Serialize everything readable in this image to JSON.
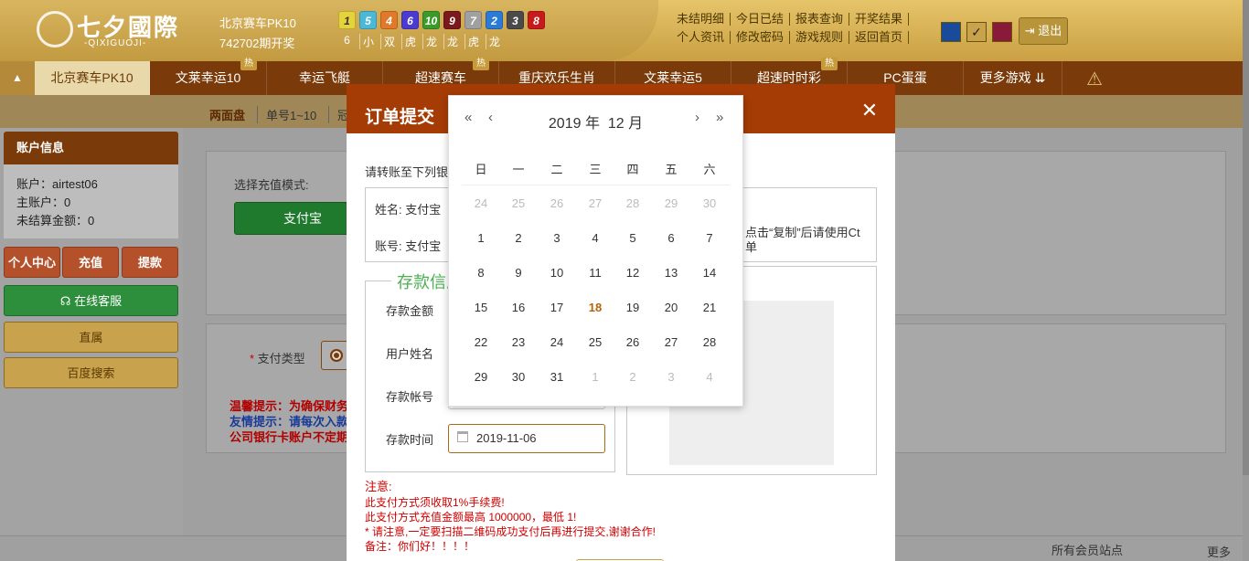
{
  "header": {
    "logo_main": "七夕國際",
    "logo_sub": "-QIXIGUOJI-",
    "game_name": "北京赛车PK10",
    "period": "742702期开奖",
    "balls": [
      {
        "n": "1",
        "color": "#e6d23a"
      },
      {
        "n": "5",
        "color": "#4bb8d8"
      },
      {
        "n": "4",
        "color": "#e07a2a"
      },
      {
        "n": "6",
        "color": "#4a3ad0"
      },
      {
        "n": "10",
        "color": "#3a9a2a"
      },
      {
        "n": "9",
        "color": "#7a1a1a"
      },
      {
        "n": "7",
        "color": "#a0a0a0"
      },
      {
        "n": "2",
        "color": "#2a7ad8"
      },
      {
        "n": "3",
        "color": "#4a4a4a"
      },
      {
        "n": "8",
        "color": "#c81a1a"
      }
    ],
    "ball_labels": [
      "6",
      "小",
      "双",
      "虎",
      "龙",
      "龙",
      "虎",
      "龙"
    ],
    "links": [
      "未结明细",
      "今日已结",
      "报表查询",
      "开奖结果",
      "个人资讯",
      "修改密码",
      "游戏规则",
      "返回首页"
    ],
    "theme_colors": [
      "#1a4a9a",
      "#c9a24e",
      "#8a1a3a"
    ],
    "logout": "退出"
  },
  "nav": {
    "tabs": [
      "北京赛车PK10",
      "文莱幸运10",
      "幸运飞艇",
      "超速赛车",
      "重庆欢乐生肖",
      "文莱幸运5",
      "超速时时彩",
      "PC蛋蛋",
      "更多游戏"
    ],
    "hot_label": "热"
  },
  "subnav": [
    "两面盘",
    "单号1~10",
    "冠"
  ],
  "account": {
    "title": "账户信息",
    "lines": [
      "账户：airtest06",
      "主账户：0",
      "未结算金额：0"
    ],
    "btn_center": "个人中心",
    "btn_deposit": "充值",
    "btn_withdraw": "提款",
    "btn_service": "在线客服",
    "btn_live": "直属",
    "btn_search": "百度搜索"
  },
  "content": {
    "mode_label": "选择充值模式:",
    "alipay": "支付宝",
    "pay_type": "支付类型",
    "tip1": "温馨提示：为确保财务",
    "tip2": "友情提示：请每次入款",
    "tip3": "公司银行卡账户不定期"
  },
  "modal": {
    "title": "订单提交",
    "transfer_text": "请转账至下列银",
    "name_label": "姓名:  支付宝",
    "account_label": "账号:  支付宝",
    "copy_hint_1": "点击“复制”后请使用Ct",
    "copy_hint_2": "单",
    "legend": "存款信息",
    "field_amount": "存款金额",
    "field_user": "用户姓名",
    "field_account": "存款帐号",
    "field_time": "存款时间",
    "time_value": "2019-11-06",
    "notes": [
      "注意:",
      "此支付方式须收取1%手续费!",
      "此支付方式充值金额最高 1000000，最低 1!",
      "* 请注意,一定要扫描二维码成功支付后再进行提交,谢谢合作!",
      "备注：你们好！！！！"
    ]
  },
  "calendar": {
    "year_label": "2019 年",
    "month_label": "12 月",
    "weekdays": [
      "日",
      "一",
      "二",
      "三",
      "四",
      "五",
      "六"
    ],
    "weeks": [
      [
        "24",
        "25",
        "26",
        "27",
        "28",
        "29",
        "30"
      ],
      [
        "1",
        "2",
        "3",
        "4",
        "5",
        "6",
        "7"
      ],
      [
        "8",
        "9",
        "10",
        "11",
        "12",
        "13",
        "14"
      ],
      [
        "15",
        "16",
        "17",
        "18",
        "19",
        "20",
        "21"
      ],
      [
        "22",
        "23",
        "24",
        "25",
        "26",
        "27",
        "28"
      ],
      [
        "29",
        "30",
        "31",
        "1",
        "2",
        "3",
        "4"
      ]
    ],
    "today": "18"
  },
  "footer": {
    "sites": "所有会员站点",
    "more": "更多"
  }
}
